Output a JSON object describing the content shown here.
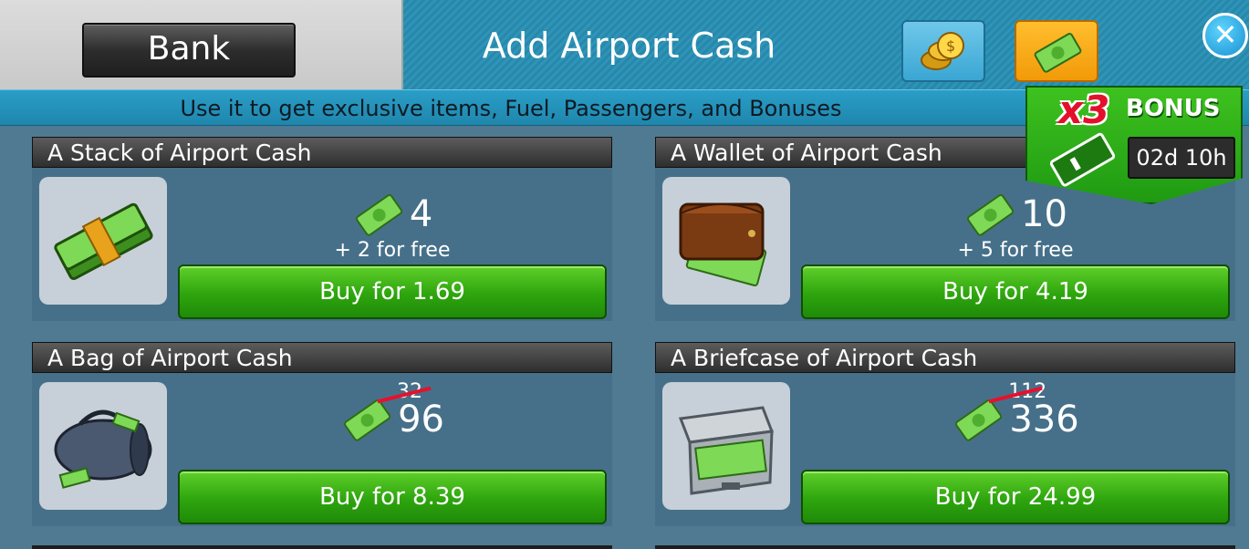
{
  "header": {
    "bank_label": "Bank",
    "title": "Add Airport Cash",
    "close_label": "✕"
  },
  "subtitle": "Use it to get exclusive items, Fuel, Passengers, and Bonuses",
  "bonus": {
    "multiplier": "x3",
    "label": "BONUS",
    "timer": "02d 10h"
  },
  "packs": [
    {
      "title": "A Stack of Airport Cash",
      "amount": "4",
      "free": "+ 2 for free",
      "old_amount": "",
      "buy_label": "Buy for 1.69",
      "icon": "cash-stack-icon"
    },
    {
      "title": "A Wallet of Airport Cash",
      "amount": "10",
      "free": "+ 5 for free",
      "old_amount": "",
      "buy_label": "Buy for 4.19",
      "icon": "wallet-icon"
    },
    {
      "title": "A Bag of Airport Cash",
      "amount": "96",
      "free": "",
      "old_amount": "32",
      "buy_label": "Buy for 8.39",
      "icon": "duffel-bag-icon"
    },
    {
      "title": "A Briefcase of Airport Cash",
      "amount": "336",
      "free": "",
      "old_amount": "112",
      "buy_label": "Buy for 24.99",
      "icon": "briefcase-icon"
    }
  ],
  "colors": {
    "accent_blue": "#2a9ec7",
    "button_green": "#2ea50e",
    "strike_red": "#e8102c"
  }
}
